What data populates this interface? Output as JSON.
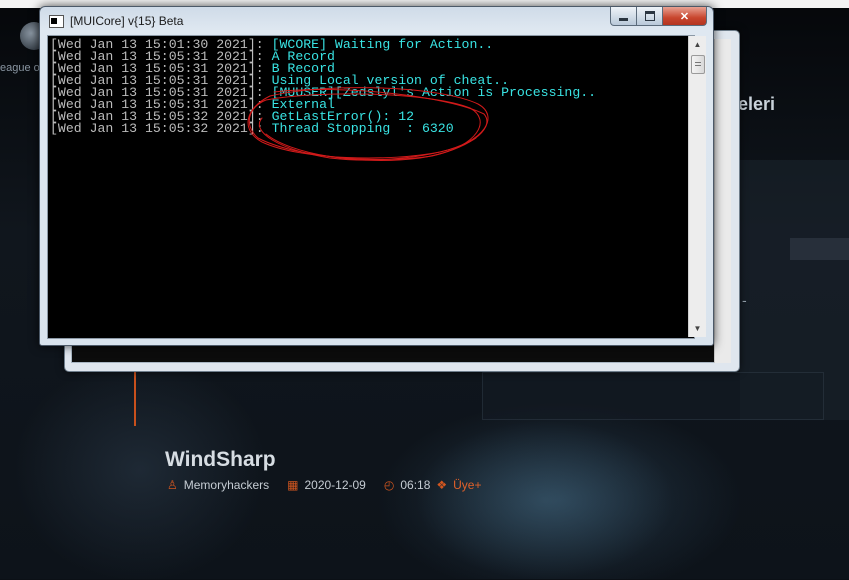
{
  "background_page": {
    "league_text": "eague o",
    "heading_fragment": "eleri",
    "dash": "-",
    "post": {
      "title": "WindSharp",
      "author": "Memoryhackers",
      "date": "2020-12-09",
      "time": "06:18",
      "status": "Üye+"
    }
  },
  "console_window": {
    "title": "[MUICore] v{15} Beta",
    "lines": [
      {
        "timestamp": "[Wed Jan 13 15:01:30 2021]: ",
        "message": "[WCORE] Waiting for Action.."
      },
      {
        "timestamp": "[Wed Jan 13 15:05:31 2021]: ",
        "message": "A Record"
      },
      {
        "timestamp": "[Wed Jan 13 15:05:31 2021]: ",
        "message": "B Record"
      },
      {
        "timestamp": "[Wed Jan 13 15:05:31 2021]: ",
        "message": "Using Local version of cheat.."
      },
      {
        "timestamp": "[Wed Jan 13 15:05:31 2021]: ",
        "message": "[MUUSER][Zedslyl's Action is Processing.."
      },
      {
        "timestamp": "[Wed Jan 13 15:05:31 2021]: ",
        "message": "External"
      },
      {
        "timestamp": "[Wed Jan 13 15:05:32 2021]: ",
        "message": "GetLastError(): 12"
      },
      {
        "timestamp": "[Wed Jan 13 15:05:32 2021]: ",
        "message": "Thread Stopping  : 6320"
      }
    ]
  },
  "colors": {
    "console_text": "#39e3e3",
    "timestamp_text": "#bcbcbc",
    "annotation": "#d11a1a",
    "accent_orange": "#d2561f"
  },
  "icons": {
    "author": "user-icon",
    "date": "calendar-icon",
    "time": "clock-icon",
    "status": "badge-icon"
  }
}
